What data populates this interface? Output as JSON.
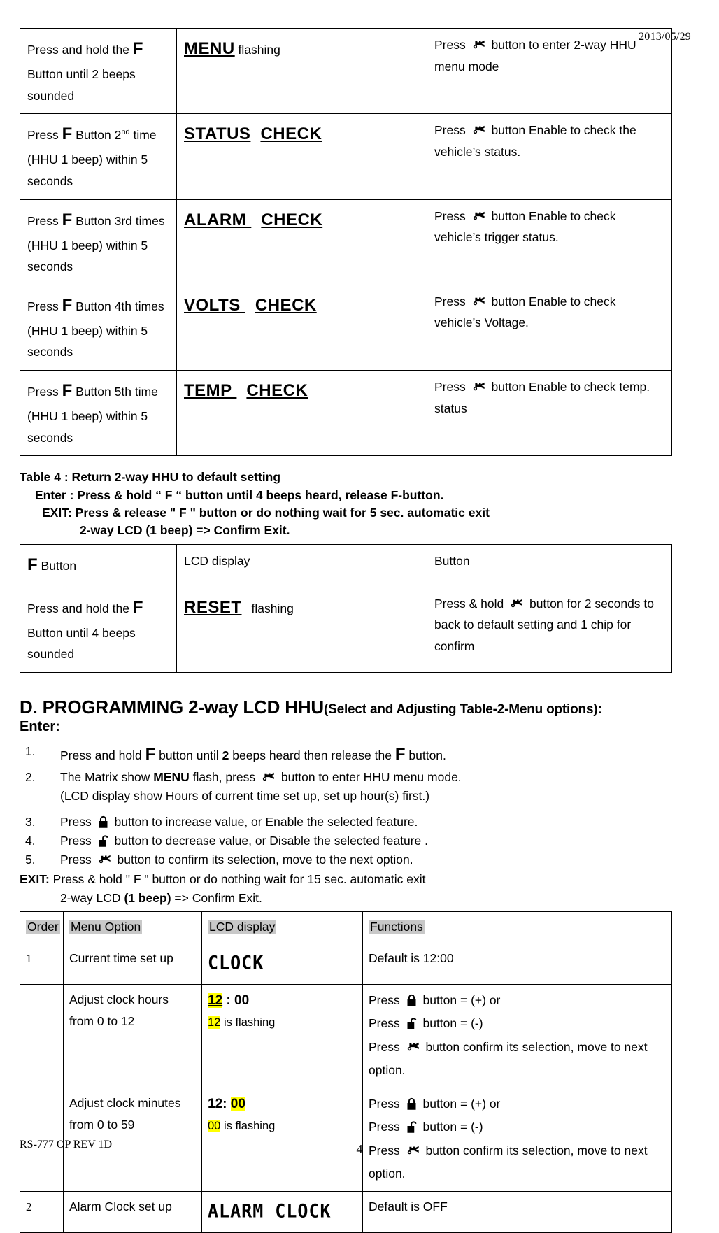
{
  "header": {
    "date": "2013/05/29"
  },
  "footer": {
    "doc_ref": "RS-777 OP REV 1D",
    "page_number": "4"
  },
  "icons": {
    "remote": "remote-key-icon",
    "lock": "padlock-closed-icon",
    "unlock": "padlock-open-icon"
  },
  "table_top": {
    "rows": [
      {
        "f_prefix": "Press and hold the",
        "f_symbol": "F",
        "f_suffix": "Button until 2 beeps sounded",
        "lcd_word": "MENU",
        "lcd_word2": "",
        "lcd_note": "flashing",
        "fn_pre": "Press",
        "fn_post": "button to enter 2-way HHU menu mode"
      },
      {
        "f_prefix": "Press",
        "f_symbol": "F",
        "f_suffix": "Button 2",
        "f_sup": "nd",
        "f_tail": "time (HHU 1 beep) within 5 seconds",
        "lcd_word": "STATUS",
        "lcd_word2": "CHECK",
        "lcd_note": "",
        "fn_pre": "Press",
        "fn_post": "button Enable to check the vehicle’s status."
      },
      {
        "f_prefix": "Press",
        "f_symbol": "F",
        "f_suffix": "Button 3rd",
        "f_sup": "",
        "f_tail": "times (HHU 1 beep) within 5 seconds",
        "lcd_word": "ALARM ",
        "lcd_word2": "CHECK",
        "lcd_note": "",
        "fn_pre": "Press",
        "fn_post": "button Enable to check vehicle’s trigger status."
      },
      {
        "f_prefix": "Press",
        "f_symbol": "F",
        "f_suffix": "Button 4th",
        "f_sup": "",
        "f_tail": "times (HHU 1 beep) within 5 seconds",
        "lcd_word": "VOLTS ",
        "lcd_word2": "CHECK",
        "lcd_note": "",
        "fn_pre": "Press",
        "fn_post": "button Enable to check vehicle’s Voltage."
      },
      {
        "f_prefix": "Press",
        "f_symbol": "F",
        "f_suffix": "Button 5th",
        "f_sup": "",
        "f_tail": "time (HHU 1 beep) within 5 seconds",
        "lcd_word": "TEMP ",
        "lcd_word2": "CHECK",
        "lcd_note": "",
        "fn_pre": "Press",
        "fn_post": "button Enable to check temp. status"
      }
    ]
  },
  "table4": {
    "title": "Table 4 : Return 2-way HHU to default setting",
    "enter": "Enter : Press & hold “ F “ button until 4 beeps heard, release F-button.",
    "exit": "EXIT: Press & release \" F \" button or do nothing wait for 5 sec. automatic exit",
    "confirm": "2-way LCD (1 beep) => Confirm Exit.",
    "head_f": "Button",
    "head_f_symbol": "F",
    "head_lcd": "LCD display",
    "head_button": "Button",
    "row": {
      "f_prefix": "Press and hold the",
      "f_symbol": "F",
      "f_suffix": "Button until 4 beeps sounded",
      "lcd_word": "RESET",
      "lcd_note": "flashing",
      "fn_pre": "Press & hold",
      "fn_post": "button for 2 seconds to back to default setting and 1 chip for confirm"
    }
  },
  "section_d": {
    "heading_main": "D. PROGRAMMING 2-way LCD HHU",
    "heading_small": "(Select and Adjusting Table-2-Menu options):",
    "enter_label": "Enter:",
    "steps": [
      {
        "num": "1.",
        "pre": "Press and hold",
        "sym": "F",
        "mid": "button until",
        "bold": "2",
        "post": "beeps heard then release the",
        "sym2": "F",
        "tail": "button."
      },
      {
        "num": "2.",
        "pre": "The Matrix show",
        "bold": "MENU",
        "mid": "flash, press",
        "icon": "remote",
        "post": "button to enter HHU menu mode."
      },
      {
        "num": "3.",
        "pre": "Press",
        "icon": "lock",
        "post": "button to increase value, or Enable the selected feature."
      },
      {
        "num": "4.",
        "pre": "Press",
        "icon": "unlock",
        "post": "button to decrease value, or Disable the selected feature ."
      },
      {
        "num": "5.",
        "pre": "Press",
        "icon": "remote",
        "post": "button to confirm its selection, move to the next option."
      }
    ],
    "step2_note": "(LCD display show Hours of current time set up, set up hour(s) first.)",
    "exit_label": "EXIT:",
    "exit_text": "Press & hold \" F \" button or do nothing wait for 15 sec. automatic exit",
    "exit_pre": "2-way LCD",
    "exit_bold": "(1 beep)",
    "exit_post": "=> Confirm Exit."
  },
  "menu_table": {
    "headers": [
      "Order",
      "Menu Option",
      "LCD display",
      "Functions"
    ],
    "rows": [
      {
        "order": "1",
        "option": "Current time set up",
        "lcd_seg": "CLOCK",
        "lcd_time": "",
        "lcd_flash": "",
        "functions": "Default is 12:00",
        "fn_bold": true,
        "fn_lines": []
      },
      {
        "order": "",
        "option": "Adjust clock hours from 0 to 12",
        "lcd_seg": "",
        "lcd_time_hl": "12",
        "lcd_time_rest": " : 00",
        "lcd_flash_hl": "12",
        "lcd_flash_rest": " is flashing",
        "functions": "",
        "fn_bold": false,
        "fn_lines": [
          {
            "pre": "Press",
            "icon": "lock",
            "post": "button = (+) or"
          },
          {
            "pre": "Press",
            "icon": "unlock",
            "post": "button = (-)"
          },
          {
            "pre": "Press",
            "icon": "remote",
            "post": "button confirm its selection, move to next option."
          }
        ]
      },
      {
        "order": "",
        "option": "Adjust clock minutes from 0 to 59",
        "lcd_seg": "",
        "lcd_time_pre": "12: ",
        "lcd_time_hl": "00",
        "lcd_time_rest": "",
        "lcd_flash_hl": "00",
        "lcd_flash_rest": " is flashing",
        "functions": "",
        "fn_bold": false,
        "fn_lines": [
          {
            "pre": "Press",
            "icon": "lock",
            "post": "button = (+) or"
          },
          {
            "pre": "Press",
            "icon": "unlock",
            "post": "button = (-)"
          },
          {
            "pre": "Press",
            "icon": "remote",
            "post": "button confirm its selection, move to next option."
          }
        ]
      },
      {
        "order": "2",
        "option": "Alarm Clock set up",
        "lcd_seg": "ALARM CLOCK",
        "lcd_time": "",
        "lcd_flash": "",
        "functions": "Default is OFF",
        "fn_bold": true,
        "fn_lines": []
      }
    ]
  }
}
